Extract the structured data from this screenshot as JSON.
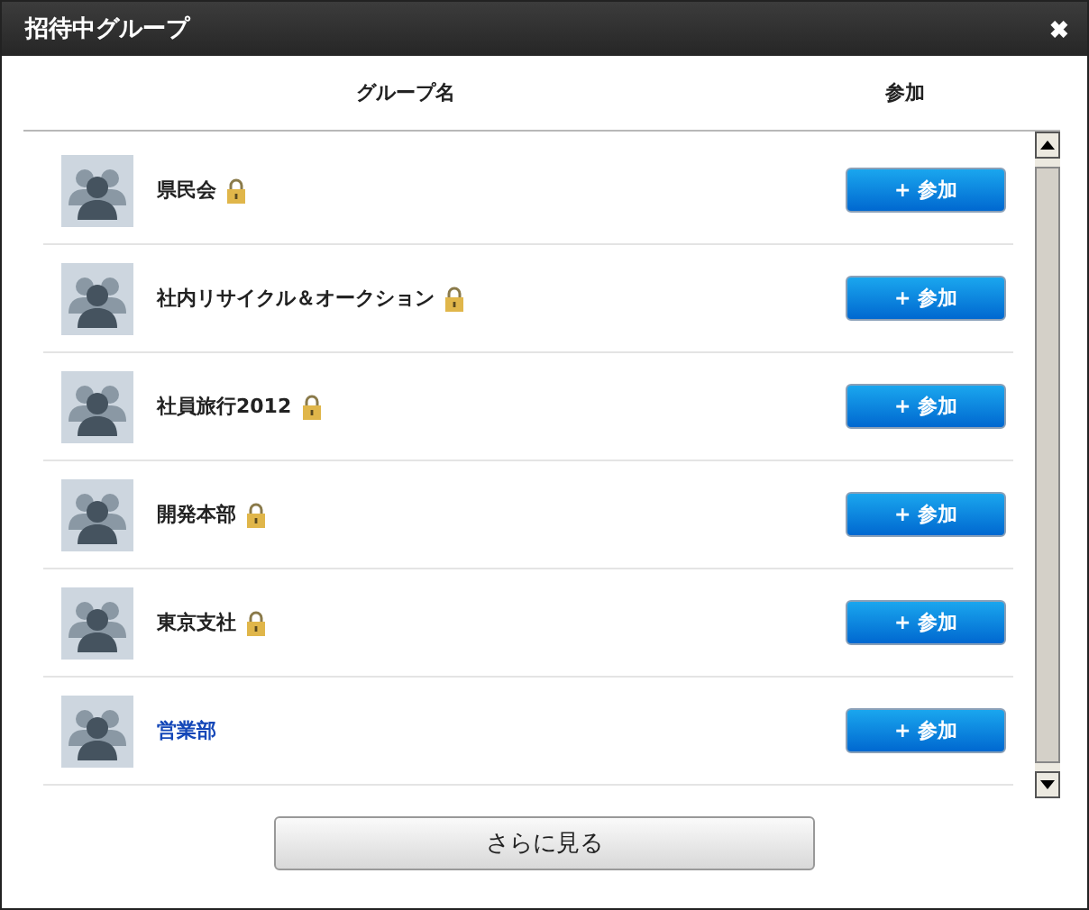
{
  "window": {
    "title": "招待中グループ",
    "close": "✖"
  },
  "table": {
    "columns": [
      "グループ名",
      "参加"
    ],
    "rows": [
      {
        "name": "県民会",
        "locked": true,
        "button": "+ 参加"
      },
      {
        "name": "社内リサイクル＆オークション",
        "locked": true,
        "button": "+ 参加"
      },
      {
        "name": "社員旅行2012",
        "locked": true,
        "button": "+ 参加"
      },
      {
        "name": "開発本部",
        "locked": true,
        "button": "+ 参加"
      },
      {
        "name": "東京支社",
        "locked": true,
        "button": "+ 参加"
      },
      {
        "name": "営業部",
        "locked": false,
        "button": "+ 参加"
      }
    ]
  },
  "more_button": "さらに見る"
}
